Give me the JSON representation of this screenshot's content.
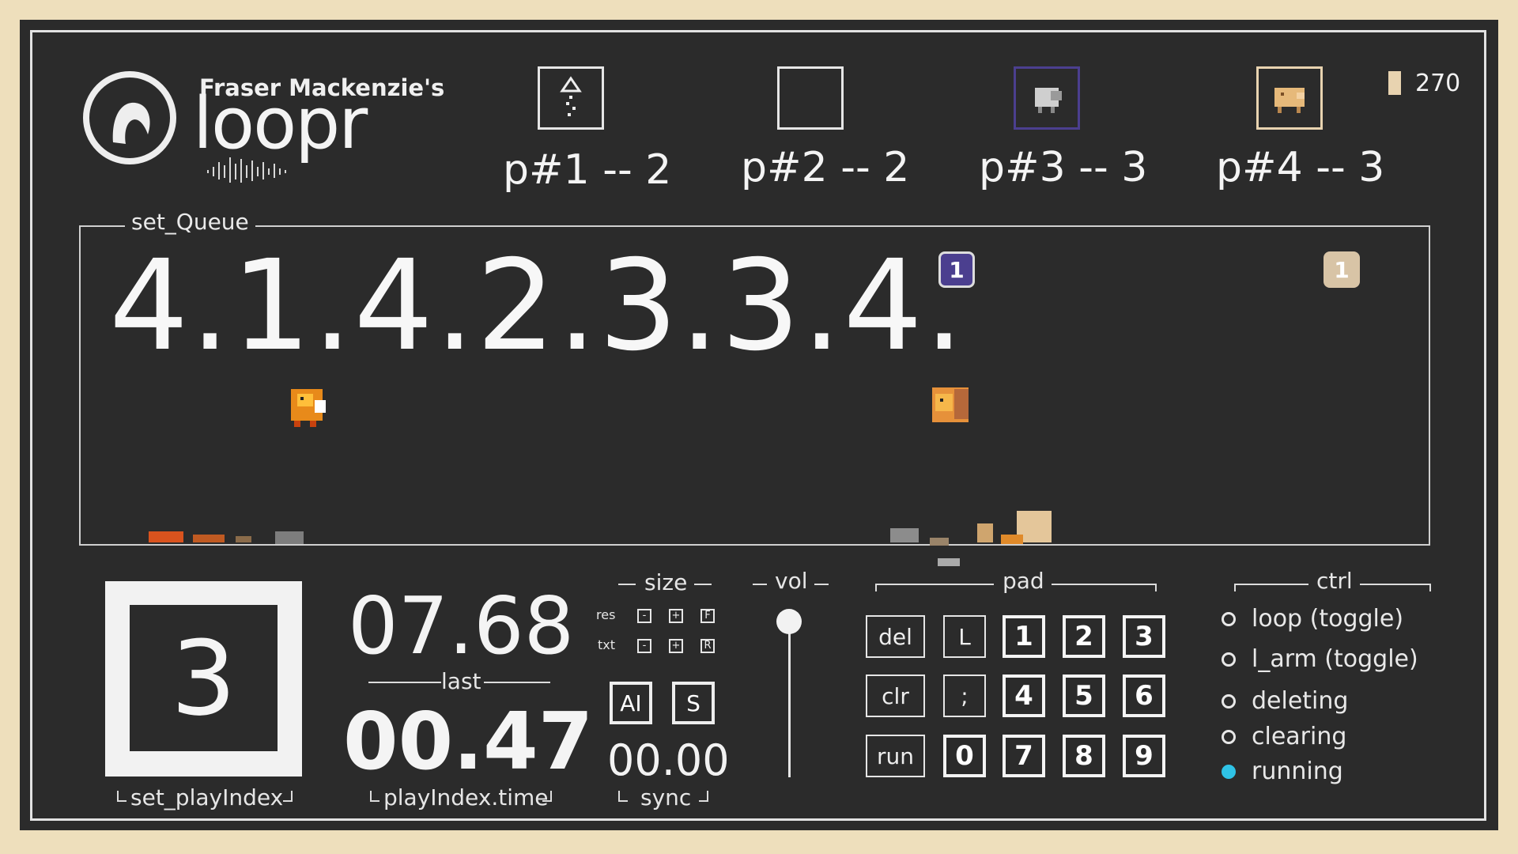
{
  "header": {
    "logo_small": "Fraser Mackenzie's",
    "logo_word": "loopr",
    "counter": "270",
    "players": [
      {
        "label": "p#1 -- 2",
        "icon": "player-1-sprite-icon"
      },
      {
        "label": "p#2 -- 2",
        "icon": "player-2-empty-icon"
      },
      {
        "label": "p#3 -- 3",
        "icon": "player-3-sheep-icon"
      },
      {
        "label": "p#4 -- 3",
        "icon": "player-4-pig-icon"
      }
    ]
  },
  "queue": {
    "label": "set_Queue",
    "sequence": "4.1.4.2.3.3.4.",
    "badge_left": "1",
    "badge_right": "1",
    "colors": {
      "badge_left": "#4b3f8f",
      "badge_right": "#d8c4a6"
    }
  },
  "play_index": {
    "value": "3",
    "label": "set_playIndex"
  },
  "timing": {
    "last_time": "07.68",
    "last_label": "last",
    "play_time": "00.47",
    "play_time_label": "playIndex.time"
  },
  "size": {
    "label": "size",
    "res_label": "res",
    "txt_label": "txt",
    "minus": "-",
    "plus": "+",
    "res_extra": "F",
    "txt_extra": "R"
  },
  "sync": {
    "ai_label": "AI",
    "s_label": "S",
    "value": "00.00",
    "label": "sync"
  },
  "vol": {
    "label": "vol"
  },
  "pad": {
    "label": "pad",
    "side_buttons": [
      "del",
      "clr",
      "run"
    ],
    "mid_buttons": [
      "L",
      ";",
      "0"
    ],
    "number_rows": [
      [
        "1",
        "2",
        "3"
      ],
      [
        "4",
        "5",
        "6"
      ],
      [
        "7",
        "8",
        "9"
      ]
    ]
  },
  "ctrl": {
    "label": "ctrl",
    "items": [
      {
        "label": "loop (toggle)",
        "active": false
      },
      {
        "label": "l_arm (toggle)",
        "active": false
      },
      {
        "label": "deleting",
        "active": false
      },
      {
        "label": "clearing",
        "active": false
      },
      {
        "label": "running",
        "active": true
      }
    ],
    "active_color": "#2fc3e6"
  }
}
